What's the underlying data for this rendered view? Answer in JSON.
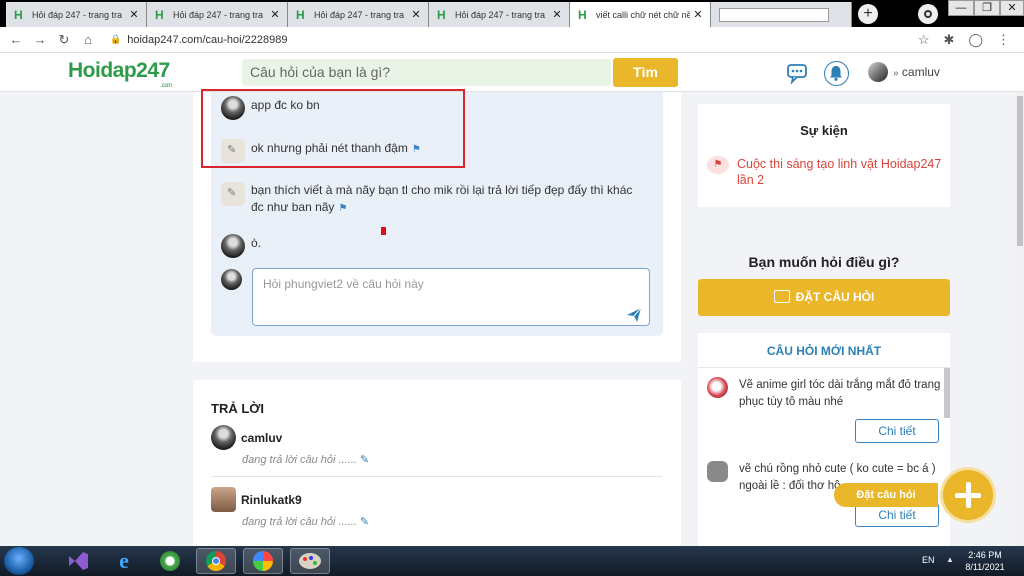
{
  "browser": {
    "tabs": [
      {
        "title": "Hỏi đáp 247 - trang tra"
      },
      {
        "title": "Hỏi đáp 247 - trang tra"
      },
      {
        "title": "Hỏi đáp 247 - trang tra"
      },
      {
        "title": "Hỏi đáp 247 - trang tra"
      },
      {
        "title": "viết calli chữ nét chữ nề"
      }
    ],
    "new_tab": "+",
    "tab_close": "✕",
    "url": "hoidap247.com/cau-hoi/2228989",
    "window_min": "—",
    "window_max": "❐",
    "window_close": "✕"
  },
  "header": {
    "logo": "Hoidap247",
    "logo_sub": ".com",
    "search_placeholder": "Câu hỏi của bạn là gì?",
    "search_button": "Tìm",
    "username": "camluv",
    "chevron": "»"
  },
  "comments": [
    {
      "text": "app đc ko bn",
      "avatar": "dark"
    },
    {
      "text": "ok  nhưng phải nét thanh đậm",
      "avatar": "light",
      "flag": true
    },
    {
      "text": "bạn thích viết à mà nãy bạn tl cho mik rồi lại trả lời tiếp đẹp đấy thì khác đc như ban nãy",
      "avatar": "light",
      "flag": true
    },
    {
      "text": "ò.",
      "avatar": "dark"
    }
  ],
  "reply": {
    "placeholder": "Hỏi phungviet2 về câu hỏi này"
  },
  "answers": {
    "title": "TRẢ LỜI",
    "items": [
      {
        "name": "camluv",
        "status": "đang trả lời câu hỏi ......"
      },
      {
        "name": "Rinlukatk9",
        "status": "đang trả lời câu hỏi ......"
      }
    ]
  },
  "sidebar": {
    "events_title": "Sự kiện",
    "event_item": "Cuộc thi sáng tạo linh vật Hoidap247 lần 2",
    "ask_title": "Bạn muốn hỏi điều gì?",
    "ask_button": "ĐẶT CÂU HỎI",
    "new_questions_title": "CÂU HỎI MỚI NHẤT",
    "questions": [
      {
        "text": "Vẽ anime girl tóc dài trắng mắt đỏ trang phục tùy tô màu nhé",
        "detail": "Chi tiết"
      },
      {
        "text": "vẽ chú rồng nhỏ cute ( ko cute = bc á ) ngoài lề : đối thơ hộ",
        "detail": "Chi tiết"
      }
    ],
    "fab_label": "Đặt câu hỏi"
  },
  "taskbar": {
    "language": "EN",
    "time": "2:46 PM",
    "date": "8/11/2021"
  },
  "colors": {
    "brand_green": "#2d9b4a",
    "brand_yellow": "#eab62a",
    "link_blue": "#2d7fb8",
    "event_red": "#d9453a",
    "highlight_red": "#d9262e"
  }
}
